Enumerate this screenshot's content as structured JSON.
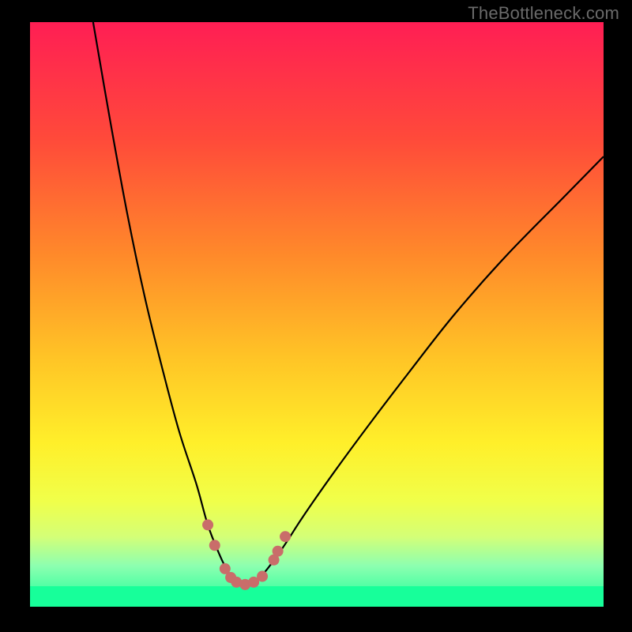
{
  "watermark": "TheBottleneck.com",
  "chart_data": {
    "type": "line",
    "title": "",
    "xlabel": "",
    "ylabel": "",
    "xlim": [
      0,
      100
    ],
    "ylim": [
      0,
      100
    ],
    "grid": false,
    "legend": false,
    "gradient_stops": [
      {
        "offset": 0,
        "color": "#ff1e54"
      },
      {
        "offset": 20,
        "color": "#ff4a3a"
      },
      {
        "offset": 40,
        "color": "#ff8a2a"
      },
      {
        "offset": 58,
        "color": "#ffc626"
      },
      {
        "offset": 72,
        "color": "#ffef2a"
      },
      {
        "offset": 82,
        "color": "#f0ff4a"
      },
      {
        "offset": 88,
        "color": "#d4ff77"
      },
      {
        "offset": 93,
        "color": "#8dffb0"
      },
      {
        "offset": 100,
        "color": "#17ff9a"
      }
    ],
    "green_band": {
      "y0": 96.5,
      "y1": 100
    },
    "series": [
      {
        "name": "bottleneck-curve",
        "x": [
          11,
          14,
          17,
          20,
          23,
          26,
          29,
          31,
          33,
          34.5,
          36,
          37.5,
          39,
          41,
          44,
          48,
          53,
          59,
          66,
          74,
          83,
          93,
          100
        ],
        "y": [
          0,
          17,
          33,
          47,
          59,
          70,
          79,
          86,
          91,
          94,
          96,
          96.5,
          96,
          94,
          90,
          84,
          77,
          69,
          60,
          50,
          40,
          30,
          23
        ]
      }
    ],
    "markers": {
      "name": "highlight-points",
      "color": "#c96d6a",
      "radius_px": 7,
      "points": [
        {
          "x": 31.0,
          "y": 86.0
        },
        {
          "x": 32.2,
          "y": 89.5
        },
        {
          "x": 34.0,
          "y": 93.5
        },
        {
          "x": 35.0,
          "y": 95.0
        },
        {
          "x": 36.0,
          "y": 95.8
        },
        {
          "x": 37.5,
          "y": 96.2
        },
        {
          "x": 39.0,
          "y": 95.8
        },
        {
          "x": 40.5,
          "y": 94.8
        },
        {
          "x": 42.5,
          "y": 92.0
        },
        {
          "x": 43.2,
          "y": 90.5
        },
        {
          "x": 44.5,
          "y": 88.0
        }
      ]
    }
  }
}
